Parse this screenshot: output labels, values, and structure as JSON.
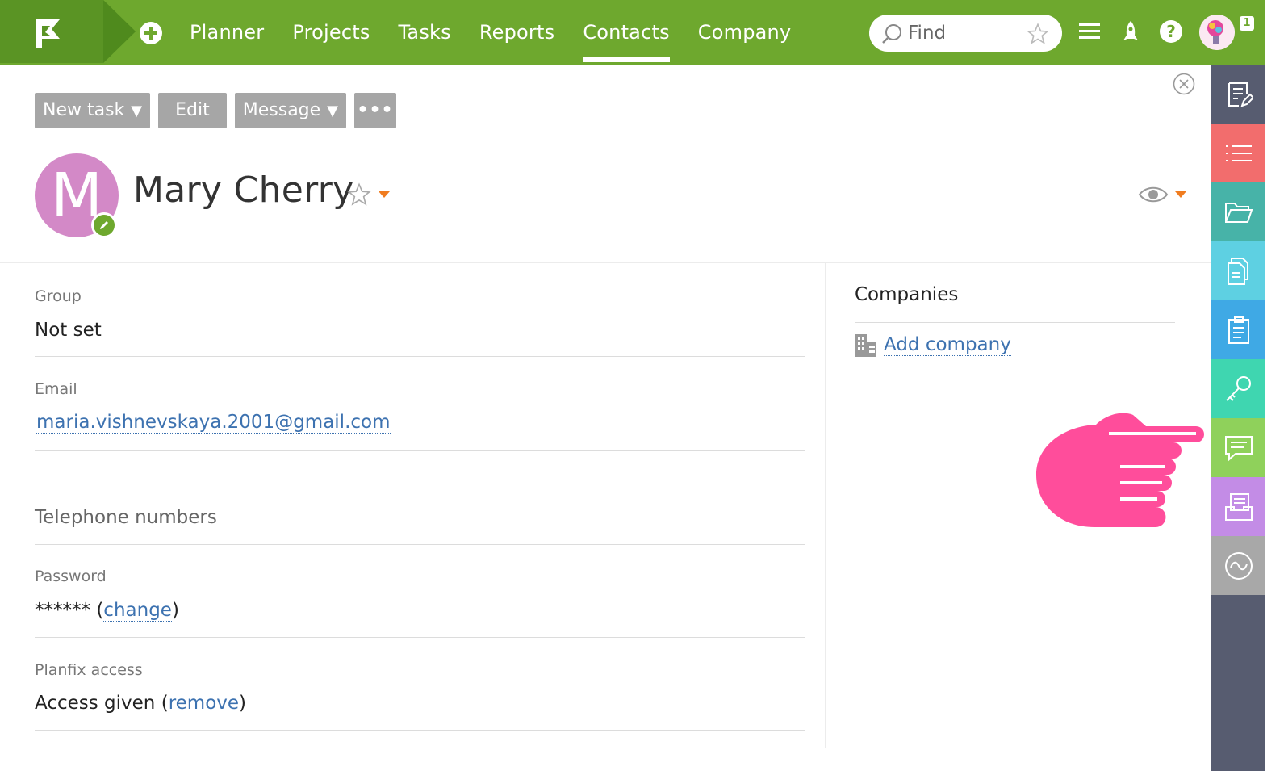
{
  "topbar": {
    "nav": [
      {
        "label": "Planner",
        "active": false
      },
      {
        "label": "Projects",
        "active": false
      },
      {
        "label": "Tasks",
        "active": false
      },
      {
        "label": "Reports",
        "active": false
      },
      {
        "label": "Contacts",
        "active": true
      },
      {
        "label": "Company",
        "active": false
      }
    ],
    "search_placeholder": "Find",
    "notification_count": "1",
    "brand_color": "#6ea82e"
  },
  "toolbar": {
    "new_task": "New task",
    "edit": "Edit",
    "message": "Message",
    "more": "•••"
  },
  "contact": {
    "initial": "M",
    "avatar_color": "#d389c7",
    "name": "Mary Cherry"
  },
  "fields": {
    "group_label": "Group",
    "group_value": "Not set",
    "email_label": "Email",
    "email_value": "maria.vishnevskaya.2001@gmail.com",
    "phones_title": "Telephone numbers",
    "password_label": "Password",
    "password_mask": "******",
    "password_change": "change",
    "access_label": "Planfix access",
    "access_value": "Access given",
    "access_remove": "remove"
  },
  "companies": {
    "title": "Companies",
    "add_label": "Add company"
  },
  "sidebar": {
    "items": [
      {
        "name": "task-form-icon",
        "color": "#575c70"
      },
      {
        "name": "list-icon",
        "color": "#f26d6d"
      },
      {
        "name": "folder-icon",
        "color": "#47b3a8"
      },
      {
        "name": "documents-icon",
        "color": "#5ed0e2"
      },
      {
        "name": "clipboard-icon",
        "color": "#3fa9e5"
      },
      {
        "name": "key-icon",
        "color": "#3fd6b0"
      },
      {
        "name": "chat-icon",
        "color": "#8fd15b"
      },
      {
        "name": "inbox-icon",
        "color": "#c38ce6"
      },
      {
        "name": "analytics-icon",
        "color": "#a8a8a8"
      }
    ]
  }
}
